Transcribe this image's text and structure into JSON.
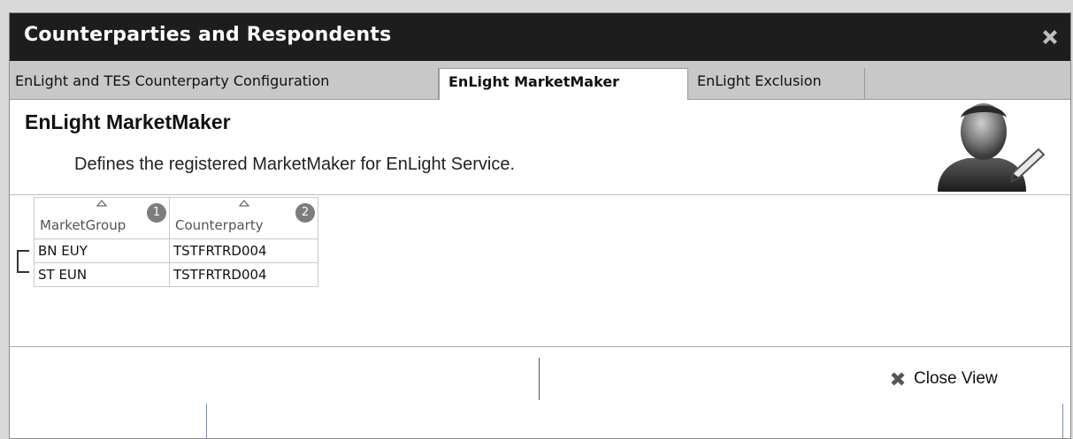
{
  "window": {
    "title": "Counterparties and Respondents",
    "close_icon": "close-x-icon"
  },
  "tabs": [
    {
      "label": "EnLight and TES Counterparty Configuration",
      "active": false
    },
    {
      "label": "EnLight MarketMaker",
      "active": true
    },
    {
      "label": "EnLight Exclusion",
      "active": false
    }
  ],
  "header": {
    "title": "EnLight MarketMaker",
    "description": "Defines the registered MarketMaker for EnLight Service.",
    "avatar_icon": "user-edit-icon"
  },
  "grid": {
    "columns": [
      {
        "label": "MarketGroup",
        "sort_order": "1",
        "sort_icon": "sort-ascending-icon"
      },
      {
        "label": "Counterparty",
        "sort_order": "2",
        "sort_icon": "sort-ascending-icon"
      }
    ],
    "rows": [
      [
        "BN EUY",
        "TSTFRTRD004"
      ],
      [
        "ST EUN",
        "TSTFRTRD004"
      ]
    ]
  },
  "footer": {
    "close_view_label": "Close View",
    "close_view_icon": "close-x-icon"
  },
  "colors": {
    "titlebar_bg": "#1d1d1d",
    "tabbar_bg": "#c8c8c8",
    "badge_bg": "#7d7d7d"
  }
}
